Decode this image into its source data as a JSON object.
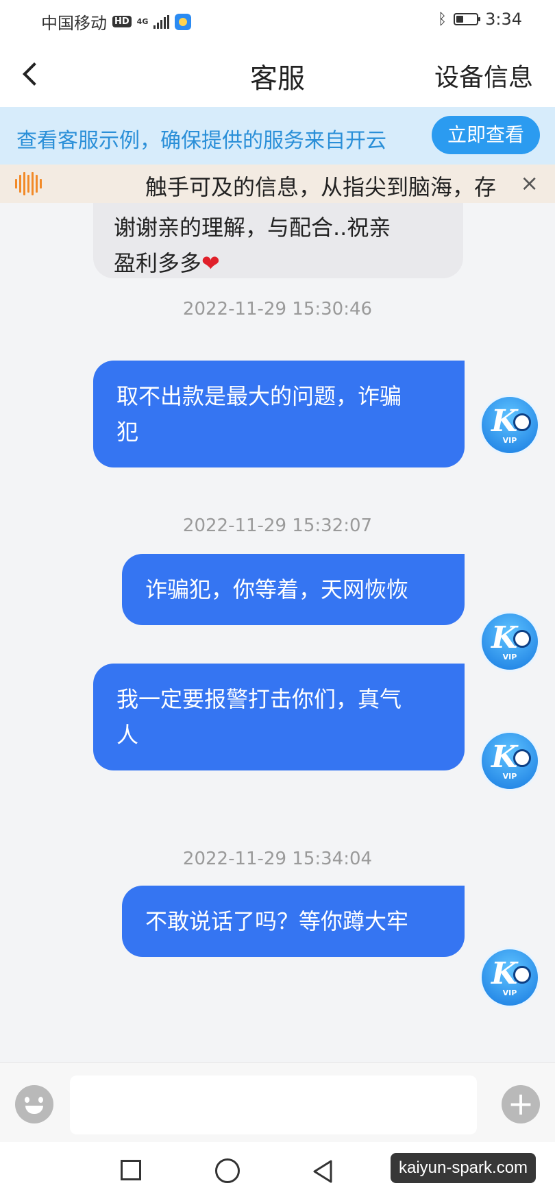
{
  "status_bar": {
    "carrier": "中国移动",
    "hd": "HD",
    "network": "4G",
    "time": "3:34"
  },
  "nav": {
    "title": "客服",
    "right_action": "设备信息"
  },
  "promo": {
    "text": "查看客服示例，确保提供的服务来自开云",
    "button": "立即查看"
  },
  "notice": {
    "text": "触手可及的信息，从指尖到脑海，存",
    "close": "×"
  },
  "messages": {
    "m0": {
      "line1": "谢谢亲的理解，与配合..祝亲",
      "line2": "盈利多多",
      "emoji": "❤"
    },
    "t1": "2022-11-29 15:30:46",
    "m1": {
      "line1": "取不出款是最大的问题，诈骗",
      "line2": "犯"
    },
    "t2": "2022-11-29 15:32:07",
    "m2": {
      "line1": "诈骗犯，你等着，天网恢恢"
    },
    "m3": {
      "line1": "我一定要报警打击你们，真气",
      "line2": "人"
    },
    "t3": "2022-11-29 15:34:04",
    "m4": {
      "line1": "不敢说话了吗？等你蹲大牢"
    }
  },
  "avatar": {
    "letter": "K",
    "badge": "VIP"
  },
  "input": {
    "placeholder": ""
  },
  "watermark": "kaiyun-spark.com",
  "colors": {
    "accent": "#3575f2",
    "promo_bg": "#d7ecfb",
    "promo_text": "#2a8fd8",
    "notice_bg": "#f3ebe2",
    "incoming_bubble": "#e9e9ec",
    "heart": "#e0202a"
  },
  "icons": {
    "back": "chevron-left-icon",
    "notice": "audio-wave-icon",
    "emoji": "smiley-icon",
    "add": "plus-icon",
    "bluetooth": "bluetooth-icon",
    "battery": "battery-icon"
  }
}
